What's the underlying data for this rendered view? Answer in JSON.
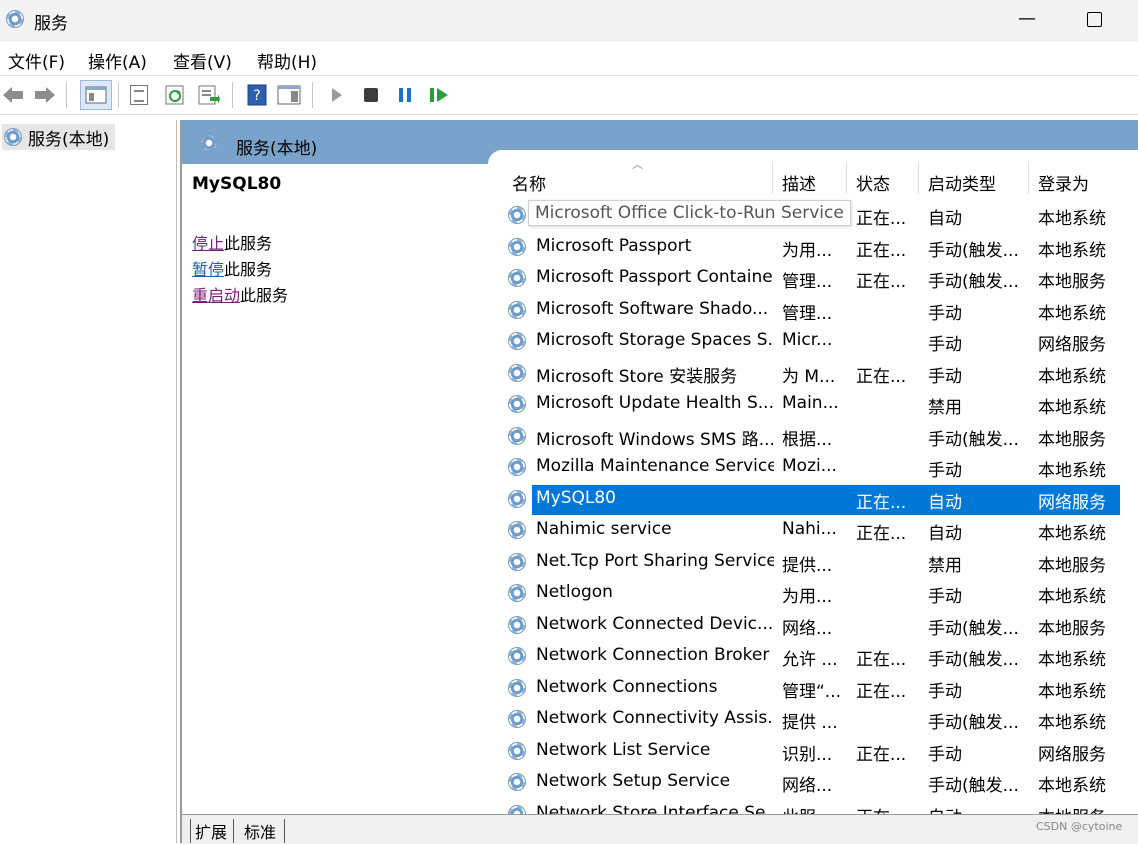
{
  "window": {
    "title": "服务",
    "minimize_glyph": "—"
  },
  "menu": [
    "文件(F)",
    "操作(A)",
    "查看(V)",
    "帮助(H)"
  ],
  "tree": {
    "root_label": "服务(本地)"
  },
  "header": {
    "title": "服务(本地)"
  },
  "extended": {
    "service_name": "MySQL80",
    "actions": [
      {
        "link": "停止",
        "rest": "此服务"
      },
      {
        "link": "暂停",
        "rest": "此服务"
      },
      {
        "link": "重启动",
        "rest": "此服务"
      }
    ]
  },
  "columns": {
    "name": "名称",
    "desc": "描述",
    "status": "状态",
    "startup": "启动类型",
    "logon": "登录为"
  },
  "tooltip": "Microsoft Office Click-to-Run Service",
  "rows": [
    {
      "name": "Microsoft Office Click-to-Run Service",
      "desc": "",
      "status": "正在...",
      "startup": "自动",
      "logon": "本地系统"
    },
    {
      "name": "Microsoft Passport",
      "desc": "为用...",
      "status": "正在...",
      "startup": "手动(触发...",
      "logon": "本地系统"
    },
    {
      "name": "Microsoft Passport Container",
      "desc": "管理...",
      "status": "正在...",
      "startup": "手动(触发...",
      "logon": "本地服务"
    },
    {
      "name": "Microsoft Software Shado...",
      "desc": "管理...",
      "status": "",
      "startup": "手动",
      "logon": "本地系统"
    },
    {
      "name": "Microsoft Storage Spaces S...",
      "desc": "Micr...",
      "status": "",
      "startup": "手动",
      "logon": "网络服务"
    },
    {
      "name": "Microsoft Store 安装服务",
      "desc": "为 M...",
      "status": "正在...",
      "startup": "手动",
      "logon": "本地系统"
    },
    {
      "name": "Microsoft Update Health S...",
      "desc": "Main...",
      "status": "",
      "startup": "禁用",
      "logon": "本地系统"
    },
    {
      "name": "Microsoft Windows SMS 路...",
      "desc": "根据...",
      "status": "",
      "startup": "手动(触发...",
      "logon": "本地服务"
    },
    {
      "name": "Mozilla Maintenance Service",
      "desc": "Mozi...",
      "status": "",
      "startup": "手动",
      "logon": "本地系统"
    },
    {
      "name": "MySQL80",
      "desc": "",
      "status": "正在...",
      "startup": "自动",
      "logon": "网络服务",
      "selected": true
    },
    {
      "name": "Nahimic service",
      "desc": "Nahi...",
      "status": "正在...",
      "startup": "自动",
      "logon": "本地系统"
    },
    {
      "name": "Net.Tcp Port Sharing Service",
      "desc": "提供...",
      "status": "",
      "startup": "禁用",
      "logon": "本地服务"
    },
    {
      "name": "Netlogon",
      "desc": "为用...",
      "status": "",
      "startup": "手动",
      "logon": "本地系统"
    },
    {
      "name": "Network Connected Devic...",
      "desc": "网络...",
      "status": "",
      "startup": "手动(触发...",
      "logon": "本地服务"
    },
    {
      "name": "Network Connection Broker",
      "desc": "允许 ...",
      "status": "正在...",
      "startup": "手动(触发...",
      "logon": "本地系统"
    },
    {
      "name": "Network Connections",
      "desc": "管理“...",
      "status": "正在...",
      "startup": "手动",
      "logon": "本地系统"
    },
    {
      "name": "Network Connectivity Assis...",
      "desc": "提供 ...",
      "status": "",
      "startup": "手动(触发...",
      "logon": "本地系统"
    },
    {
      "name": "Network List Service",
      "desc": "识别...",
      "status": "正在...",
      "startup": "手动",
      "logon": "网络服务"
    },
    {
      "name": "Network Setup Service",
      "desc": "网络...",
      "status": "",
      "startup": "手动(触发...",
      "logon": "本地系统"
    },
    {
      "name": "Network Store Interface Se...",
      "desc": "此服...",
      "status": "正在...",
      "startup": "自动",
      "logon": "本地服务"
    }
  ],
  "tabs": [
    "扩展",
    "标准"
  ],
  "watermark": "CSDN @cytoine",
  "icons": {
    "toolbar": [
      "back-arrow-icon",
      "forward-arrow-icon",
      "console-tree-icon",
      "properties-icon",
      "refresh-icon",
      "export-list-icon",
      "help-icon",
      "show-hide-action-pane-icon",
      "start-service-icon",
      "stop-service-icon",
      "pause-service-icon",
      "restart-service-icon"
    ]
  },
  "colors": {
    "selection": "#0078d7",
    "header_band": "#7aa3cb",
    "play": "#2a9d3a",
    "pause": "#1c72c9"
  }
}
